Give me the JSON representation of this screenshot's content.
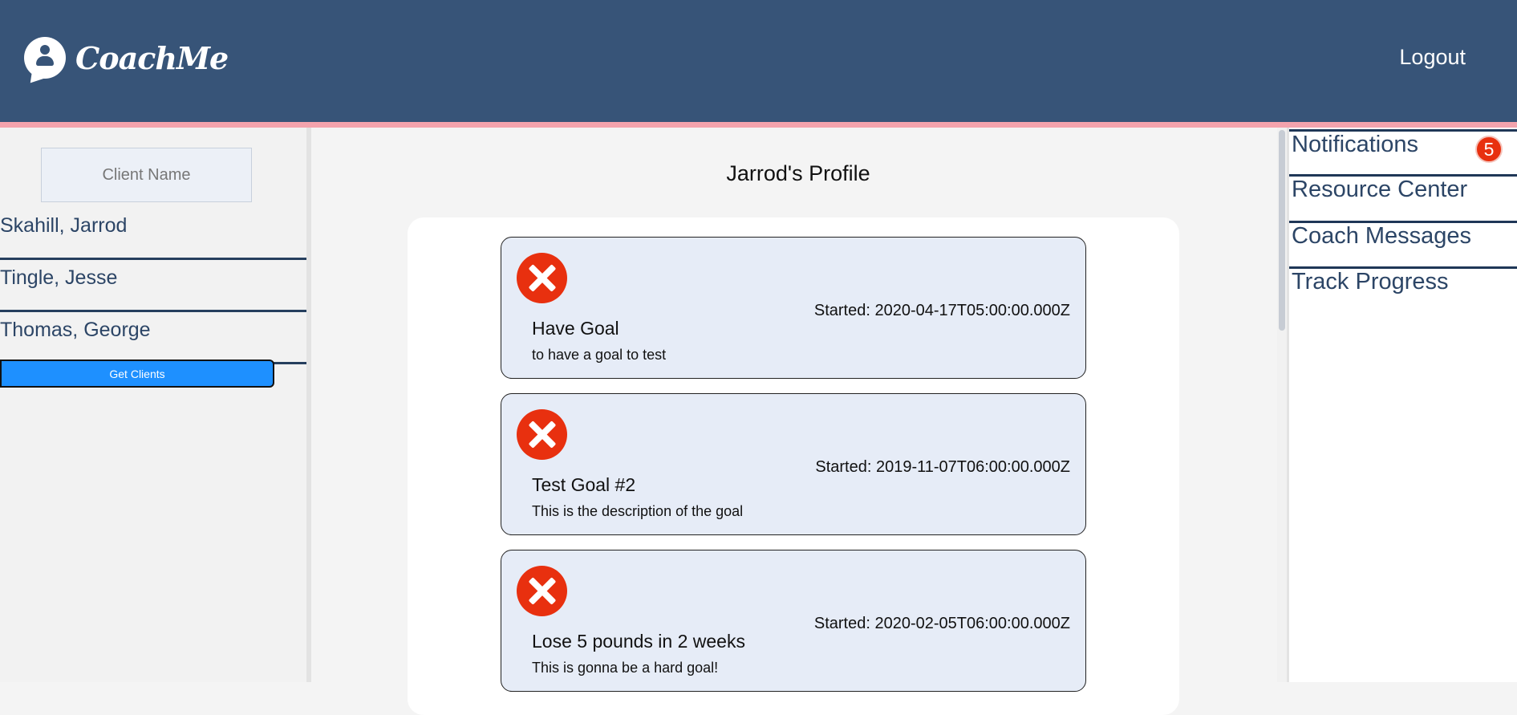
{
  "header": {
    "brand": "CoachMe",
    "logout_label": "Logout"
  },
  "sidebar": {
    "search_placeholder": "Client Name",
    "clients": [
      {
        "name": "Skahill, Jarrod"
      },
      {
        "name": "Tingle, Jesse"
      },
      {
        "name": "Thomas, George"
      }
    ],
    "get_clients_label": "Get Clients"
  },
  "main": {
    "profile_title": "Jarrod's Profile",
    "goals": [
      {
        "title": "Have Goal",
        "description": "to have a goal to test",
        "started": "Started: 2020-04-17T05:00:00.000Z",
        "icon": "close-circle-icon"
      },
      {
        "title": "Test Goal #2",
        "description": "This is the description of the goal",
        "started": "Started: 2019-11-07T06:00:00.000Z",
        "icon": "close-circle-icon"
      },
      {
        "title": "Lose 5 pounds in 2 weeks",
        "description": "This is gonna be a hard goal!",
        "started": "Started: 2020-02-05T06:00:00.000Z",
        "icon": "close-circle-icon"
      }
    ]
  },
  "right_nav": {
    "items": [
      {
        "label": "Notifications"
      },
      {
        "label": "Resource Center"
      },
      {
        "label": "Coach Messages"
      },
      {
        "label": "Track Progress"
      }
    ],
    "notification_count": "5"
  },
  "colors": {
    "header_bg": "#375478",
    "header_stripe": "#f4a3ad",
    "button_blue": "#1e90ff",
    "delete_red": "#e8300f",
    "card_bg": "#e6ecf7",
    "nav_text": "#2c4566"
  }
}
